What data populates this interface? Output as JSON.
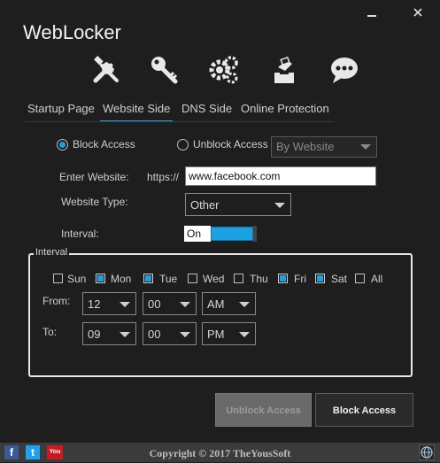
{
  "window": {
    "title": "WebLocker"
  },
  "tabs": [
    {
      "label": "Startup Page",
      "active": false
    },
    {
      "label": "Website Side",
      "active": true
    },
    {
      "label": "DNS Side",
      "active": false
    },
    {
      "label": "Online Protection",
      "active": false
    }
  ],
  "toolbar_icons": [
    "tools-icon",
    "key-icon",
    "gears-icon",
    "hand-vote-icon",
    "chat-bubble-icon"
  ],
  "mode": {
    "block_label": "Block Access",
    "unblock_label": "Unblock Access",
    "selected": "block",
    "unblock_method": "By Website"
  },
  "website": {
    "label": "Enter Website:",
    "prefix": "https://",
    "value": "www.facebook.com"
  },
  "website_type": {
    "label": "Website Type:",
    "value": "Other"
  },
  "interval": {
    "label": "Interval:",
    "toggle_text": "On",
    "group_title": "Interval",
    "days": [
      {
        "label": "Sun",
        "checked": false
      },
      {
        "label": "Mon",
        "checked": true
      },
      {
        "label": "Tue",
        "checked": true
      },
      {
        "label": "Wed",
        "checked": false
      },
      {
        "label": "Thu",
        "checked": false
      },
      {
        "label": "Fri",
        "checked": true
      },
      {
        "label": "Sat",
        "checked": true
      },
      {
        "label": "All",
        "checked": false
      }
    ],
    "from_label": "From:",
    "from": {
      "hour": "12",
      "minute": "00",
      "ampm": "AM"
    },
    "to_label": "To:",
    "to": {
      "hour": "09",
      "minute": "00",
      "ampm": "PM"
    }
  },
  "buttons": {
    "unblock": "Unblock Access",
    "block": "Block Access"
  },
  "footer": {
    "copyright": "Copyright © 2017 TheYousSoft",
    "social": [
      "f",
      "t",
      "You"
    ]
  },
  "colors": {
    "accent": "#1ba1e2",
    "background": "#1e1e1e",
    "footer": "#3b3b3b"
  }
}
